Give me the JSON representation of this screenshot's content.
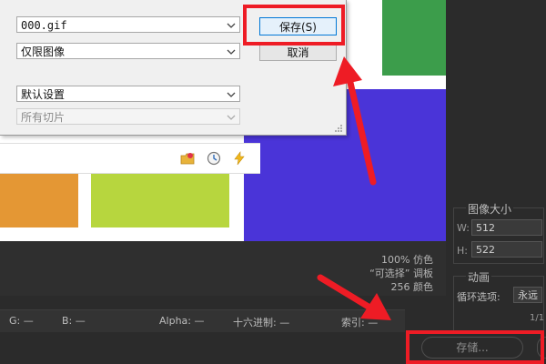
{
  "dialog": {
    "filename_value": "000.gif",
    "type_value": "仅限图像",
    "settings_value": "默认设置",
    "slices_value": "所有切片",
    "save_label": "保存(S)",
    "cancel_label": "取消"
  },
  "info": {
    "line1": "100% 仿色",
    "line2": "“可选择” 调板",
    "line3": "256 颜色"
  },
  "status": {
    "g": "G: —",
    "b": "B: —",
    "alpha": "Alpha: —",
    "hex": "十六进制: —",
    "index": "索引: —"
  },
  "right_panel": {
    "image_size_title": "图像大小",
    "width_label": "W:",
    "width_value": "512",
    "height_label": "H:",
    "height_value": "522",
    "animation_title": "动画",
    "loop_label": "循环选项:",
    "loop_value": "永远",
    "frame_counter": "1/1"
  },
  "bottom": {
    "store_label": "存储..."
  },
  "colors": {
    "highlight_red": "#ee1c25",
    "green_block": "#3c9d4b",
    "blue_block": "#4a34d8",
    "orange_block": "#e49734",
    "lime_block": "#b7d63e"
  }
}
